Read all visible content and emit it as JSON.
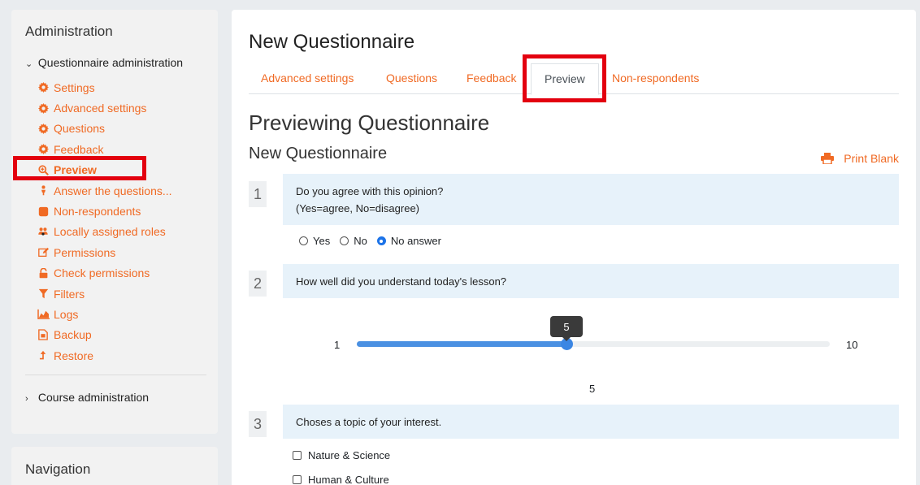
{
  "sidebar": {
    "block_title": "Administration",
    "questionnaire_admin": "Questionnaire administration",
    "items": [
      {
        "label": "Settings",
        "icon": "gear-icon"
      },
      {
        "label": "Advanced settings",
        "icon": "gear-icon"
      },
      {
        "label": "Questions",
        "icon": "gear-icon"
      },
      {
        "label": "Feedback",
        "icon": "gear-icon"
      },
      {
        "label": "Preview",
        "icon": "search-plus-icon"
      },
      {
        "label": "Answer the questions...",
        "icon": "person-icon"
      },
      {
        "label": "Non-respondents",
        "icon": "square-icon"
      },
      {
        "label": "Locally assigned roles",
        "icon": "users-icon"
      },
      {
        "label": "Permissions",
        "icon": "edit-icon"
      },
      {
        "label": "Check permissions",
        "icon": "unlock-icon"
      },
      {
        "label": "Filters",
        "icon": "filter-icon"
      },
      {
        "label": "Logs",
        "icon": "chart-area-icon"
      },
      {
        "label": "Backup",
        "icon": "file-icon"
      },
      {
        "label": "Restore",
        "icon": "arrow-up-icon"
      }
    ],
    "course_admin": "Course administration",
    "nav_title": "Navigation"
  },
  "main": {
    "title": "New Questionnaire",
    "tabs": [
      {
        "label": "Advanced settings"
      },
      {
        "label": "Questions"
      },
      {
        "label": "Feedback"
      },
      {
        "label": "Preview"
      },
      {
        "label": "Non-respondents"
      }
    ],
    "heading": "Previewing Questionnaire",
    "questionnaire_title": "New Questionnaire",
    "print_blank": "Print Blank"
  },
  "questions": [
    {
      "number": "1",
      "line1": "Do you agree with this opinion?",
      "line2": "(Yes=agree, No=disagree)",
      "options": [
        "Yes",
        "No",
        "No answer"
      ],
      "selected": "No answer"
    },
    {
      "number": "2",
      "text": "How well did you understand today's lesson?",
      "min_label": "1",
      "max_label": "10",
      "value": "5",
      "value_fraction": 0.444
    },
    {
      "number": "3",
      "text": "Choses a topic of your interest.",
      "options": [
        "Nature & Science",
        "Human & Culture"
      ]
    }
  ],
  "colors": {
    "accent": "#f06a24",
    "highlight": "#e3000f",
    "slider": "#4a90e2"
  }
}
